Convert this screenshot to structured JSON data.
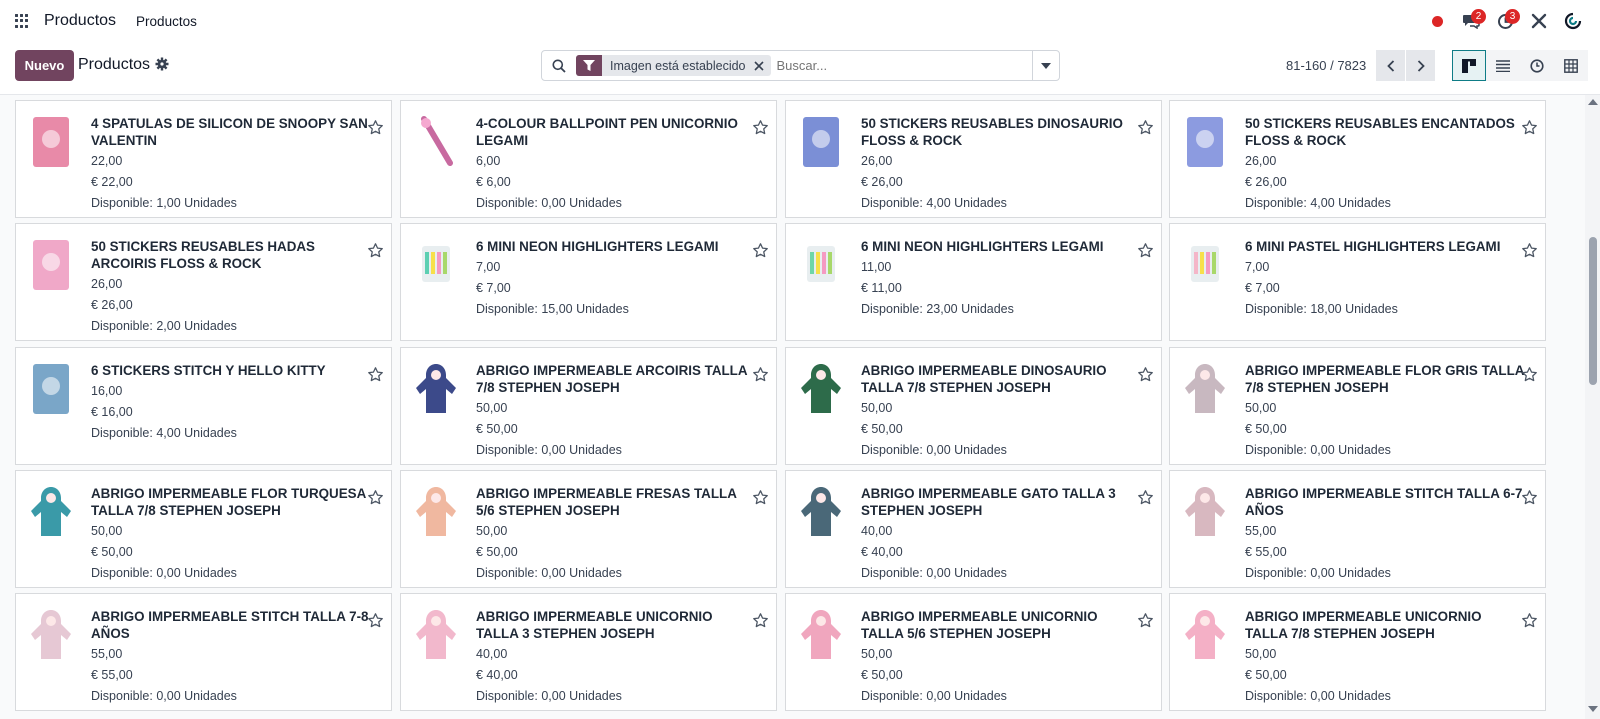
{
  "navbar": {
    "brand": "Productos",
    "menu": [
      "Productos"
    ],
    "messages_badge": "2",
    "activities_badge": "3"
  },
  "control": {
    "new_label": "Nuevo",
    "title": "Productos",
    "facet_label": "Imagen está establecido",
    "search_placeholder": "Buscar...",
    "pager": "81-160 / 7823"
  },
  "colors": {
    "primary": "#71445f",
    "accent": "#0e7c86",
    "badge": "#dc2626"
  },
  "products": [
    {
      "name": "4 SPATULAS DE SILICON DE SNOOPY SAN VALENTIN",
      "cost": "22,00",
      "price": "€ 22,00",
      "stock": "Disponible: 1,00 Unidades",
      "icon": "spatula-icon"
    },
    {
      "name": "4-COLOUR BALLPOINT PEN UNICORNIO LEGAMI",
      "cost": "6,00",
      "price": "€ 6,00",
      "stock": "Disponible: 0,00 Unidades",
      "icon": "pen-icon"
    },
    {
      "name": "50 STICKERS REUSABLES DINOSAURIO FLOSS & ROCK",
      "cost": "26,00",
      "price": "€ 26,00",
      "stock": "Disponible: 4,00 Unidades",
      "icon": "sticker-book-icon"
    },
    {
      "name": "50 STICKERS REUSABLES ENCANTADOS FLOSS & ROCK",
      "cost": "26,00",
      "price": "€ 26,00",
      "stock": "Disponible: 4,00 Unidades",
      "icon": "sticker-book-icon"
    },
    {
      "name": "50 STICKERS REUSABLES HADAS ARCOIRIS FLOSS & ROCK",
      "cost": "26,00",
      "price": "€ 26,00",
      "stock": "Disponible: 2,00 Unidades",
      "icon": "sticker-book-icon"
    },
    {
      "name": "6 MINI NEON HIGHLIGHTERS LEGAMI",
      "cost": "7,00",
      "price": "€ 7,00",
      "stock": "Disponible: 15,00 Unidades",
      "icon": "highlighter-icon"
    },
    {
      "name": "6 MINI NEON HIGHLIGHTERS LEGAMI",
      "cost": "11,00",
      "price": "€ 11,00",
      "stock": "Disponible: 23,00 Unidades",
      "icon": "highlighter-icon"
    },
    {
      "name": "6 MINI PASTEL HIGHLIGHTERS LEGAMI",
      "cost": "7,00",
      "price": "€ 7,00",
      "stock": "Disponible: 18,00 Unidades",
      "icon": "highlighter-icon"
    },
    {
      "name": "6 STICKERS STITCH Y HELLO KITTY",
      "cost": "16,00",
      "price": "€ 16,00",
      "stock": "Disponible: 4,00 Unidades",
      "icon": "sticker-pack-icon"
    },
    {
      "name": "ABRIGO IMPERMEABLE ARCOIRIS TALLA 7/8 STEPHEN JOSEPH",
      "cost": "50,00",
      "price": "€ 50,00",
      "stock": "Disponible: 0,00 Unidades",
      "icon": "raincoat-icon"
    },
    {
      "name": "ABRIGO IMPERMEABLE DINOSAURIO TALLA 7/8 STEPHEN JOSEPH",
      "cost": "50,00",
      "price": "€ 50,00",
      "stock": "Disponible: 0,00 Unidades",
      "icon": "raincoat-icon"
    },
    {
      "name": "ABRIGO IMPERMEABLE FLOR GRIS TALLA 7/8 STEPHEN JOSEPH",
      "cost": "50,00",
      "price": "€ 50,00",
      "stock": "Disponible: 0,00 Unidades",
      "icon": "raincoat-icon"
    },
    {
      "name": "ABRIGO IMPERMEABLE FLOR TURQUESA TALLA 7/8 STEPHEN JOSEPH",
      "cost": "50,00",
      "price": "€ 50,00",
      "stock": "Disponible: 0,00 Unidades",
      "icon": "raincoat-icon"
    },
    {
      "name": "ABRIGO IMPERMEABLE FRESAS TALLA 5/6 STEPHEN JOSEPH",
      "cost": "50,00",
      "price": "€ 50,00",
      "stock": "Disponible: 0,00 Unidades",
      "icon": "raincoat-icon"
    },
    {
      "name": "ABRIGO IMPERMEABLE GATO TALLA 3 STEPHEN JOSEPH",
      "cost": "40,00",
      "price": "€ 40,00",
      "stock": "Disponible: 0,00 Unidades",
      "icon": "raincoat-icon"
    },
    {
      "name": "ABRIGO IMPERMEABLE STITCH TALLA 6-7 AÑOS",
      "cost": "55,00",
      "price": "€ 55,00",
      "stock": "Disponible: 0,00 Unidades",
      "icon": "raincoat-photo-icon"
    },
    {
      "name": "ABRIGO IMPERMEABLE STITCH TALLA 7-8 AÑOS",
      "cost": "55,00",
      "price": "€ 55,00",
      "stock": "Disponible: 0,00 Unidades",
      "icon": "raincoat-photo-icon"
    },
    {
      "name": "ABRIGO IMPERMEABLE UNICORNIO TALLA 3 STEPHEN JOSEPH",
      "cost": "40,00",
      "price": "€ 40,00",
      "stock": "Disponible: 0,00 Unidades",
      "icon": "raincoat-icon"
    },
    {
      "name": "ABRIGO IMPERMEABLE UNICORNIO TALLA 5/6 STEPHEN JOSEPH",
      "cost": "50,00",
      "price": "€ 50,00",
      "stock": "Disponible: 0,00 Unidades",
      "icon": "raincoat-icon"
    },
    {
      "name": "ABRIGO IMPERMEABLE UNICORNIO TALLA 7/8 STEPHEN JOSEPH",
      "cost": "50,00",
      "price": "€ 50,00",
      "stock": "Disponible: 0,00 Unidades",
      "icon": "raincoat-icon"
    }
  ]
}
